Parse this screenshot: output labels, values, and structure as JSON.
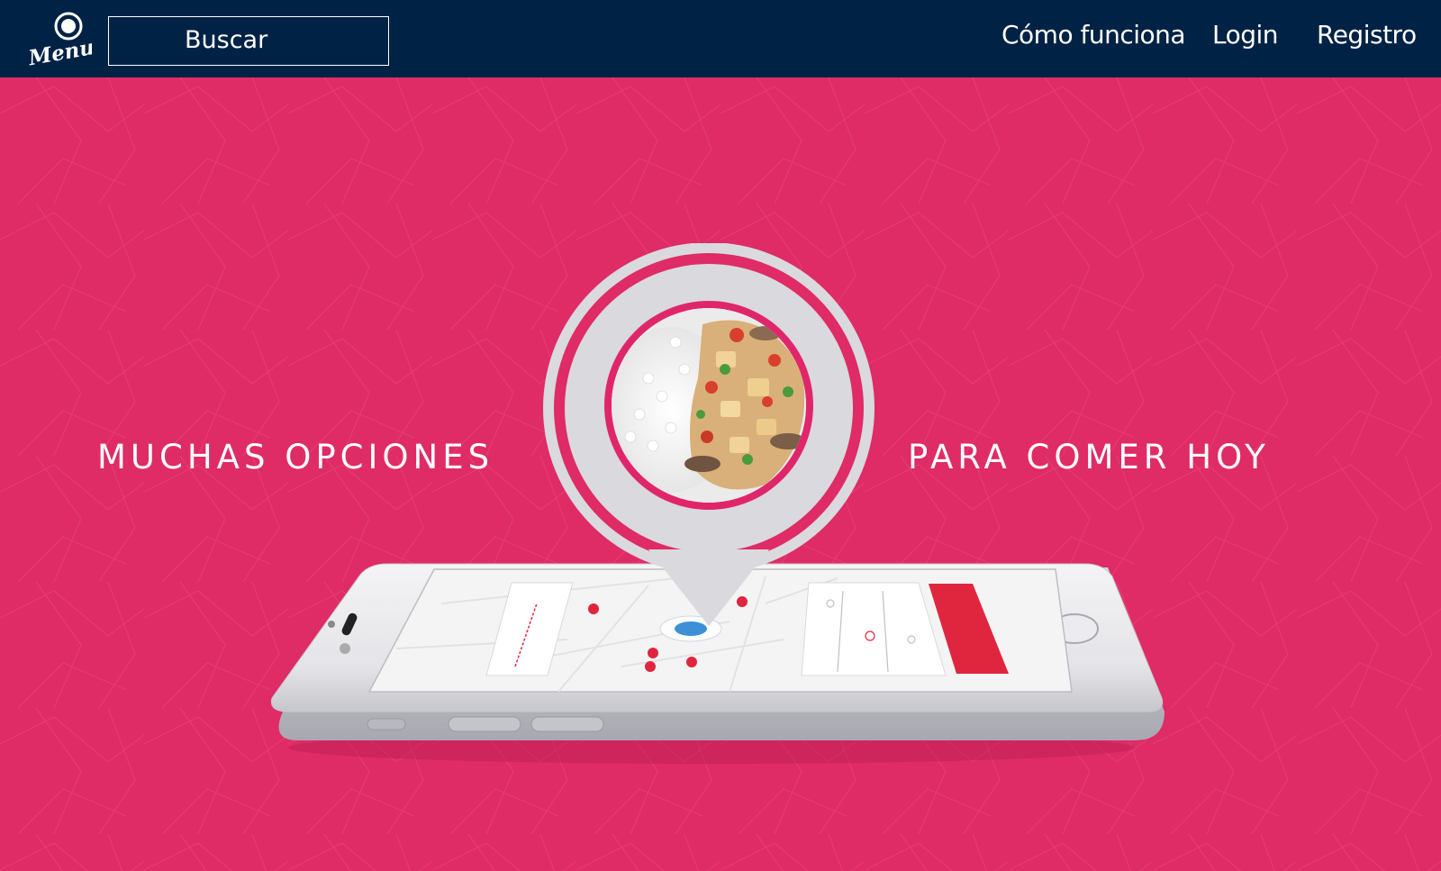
{
  "header": {
    "logo_text": "Menu",
    "search_label": "Buscar",
    "nav": {
      "how_it_works": "Cómo funciona",
      "login": "Login",
      "register": "Registro"
    }
  },
  "hero": {
    "text_left": "MUCHAS OPCIONES",
    "text_right": "PARA COMER HOY",
    "icons": {
      "pin": "location-pin-icon",
      "phone": "smartphone-icon",
      "dish": "rice-stir-fry-dish"
    }
  },
  "colors": {
    "navbar": "#002244",
    "hero_background": "#df2b66",
    "accent_red": "#e0263f",
    "pin_grey": "#d9d9de",
    "map_blue": "#3d8fd6"
  }
}
